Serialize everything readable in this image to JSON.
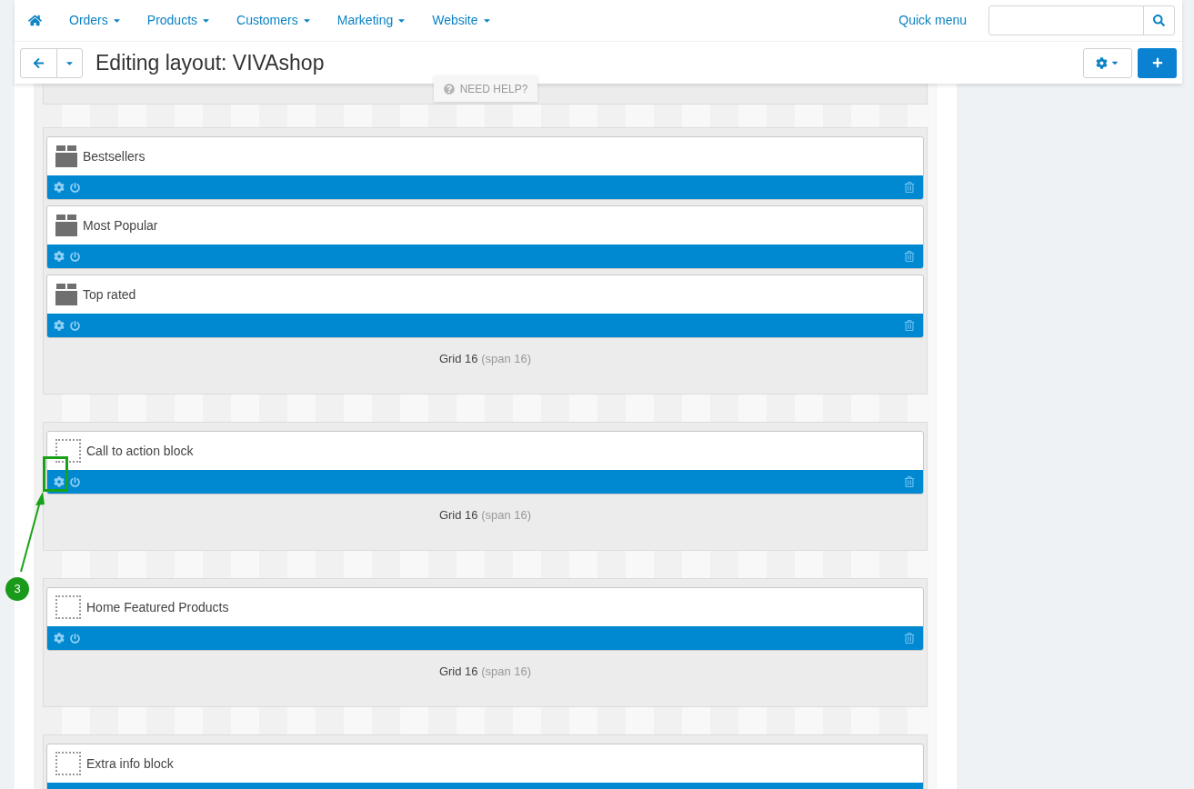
{
  "nav": {
    "items": [
      {
        "label": "Orders"
      },
      {
        "label": "Products"
      },
      {
        "label": "Customers"
      },
      {
        "label": "Marketing"
      },
      {
        "label": "Website"
      }
    ],
    "quick_menu": "Quick menu"
  },
  "page": {
    "title": "Editing layout: VIVAshop"
  },
  "help_tab": "NEED HELP?",
  "grids": [
    {
      "blocks": [
        {
          "kind": "product",
          "title": "Bestsellers"
        },
        {
          "kind": "product",
          "title": "Most Popular"
        },
        {
          "kind": "product",
          "title": "Top rated"
        }
      ],
      "label": "Grid 16",
      "span": "(span 16)"
    },
    {
      "blocks": [
        {
          "kind": "placeholder",
          "title": "Call to action block"
        }
      ],
      "label": "Grid 16",
      "span": "(span 16)"
    },
    {
      "blocks": [
        {
          "kind": "placeholder",
          "title": "Home Featured Products"
        }
      ],
      "label": "Grid 16",
      "span": "(span 16)"
    },
    {
      "blocks": [
        {
          "kind": "placeholder",
          "title": "Extra info block"
        }
      ]
    }
  ],
  "callout": {
    "number": "3"
  }
}
